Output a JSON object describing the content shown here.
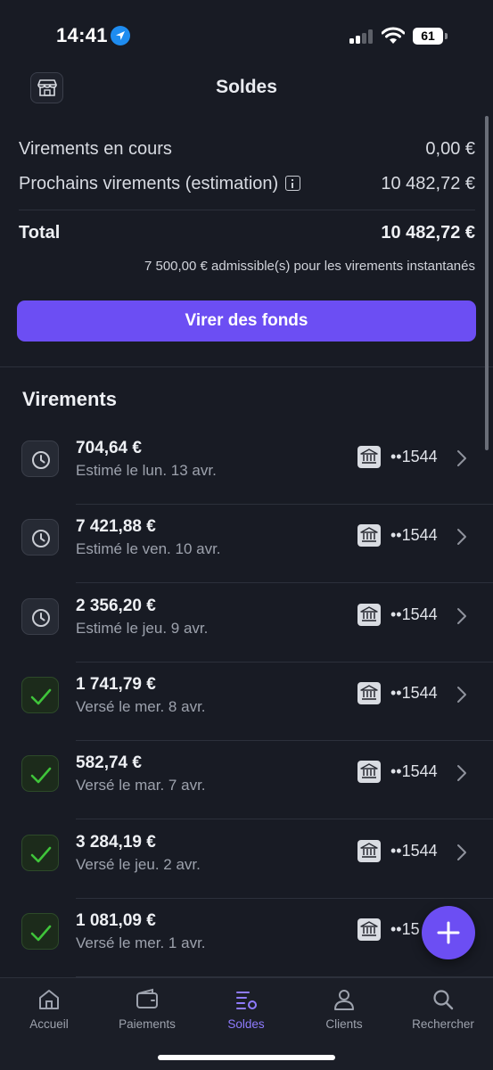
{
  "status_bar": {
    "time": "14:41",
    "battery": "61"
  },
  "header": {
    "title": "Soldes",
    "store_icon": "store-icon"
  },
  "summary": {
    "pending_label": "Virements en cours",
    "pending_value": "0,00 €",
    "upcoming_label": "Prochains virements (estimation)",
    "upcoming_value": "10 482,72 €",
    "total_label": "Total",
    "total_value": "10 482,72 €",
    "eligible_note": "7 500,00 € admissible(s) pour les virements instantanés"
  },
  "actions": {
    "transfer_button": "Virer des fonds"
  },
  "transfers": {
    "title": "Virements",
    "items": [
      {
        "amount": "704,64 €",
        "date": "Estimé le lun. 13 avr.",
        "status": "pending",
        "account": "••1544"
      },
      {
        "amount": "7 421,88 €",
        "date": "Estimé le ven. 10 avr.",
        "status": "pending",
        "account": "••1544"
      },
      {
        "amount": "2 356,20 €",
        "date": "Estimé le jeu. 9 avr.",
        "status": "pending",
        "account": "••1544"
      },
      {
        "amount": "1 741,79 €",
        "date": "Versé le mer. 8 avr.",
        "status": "paid",
        "account": "••1544"
      },
      {
        "amount": "582,74 €",
        "date": "Versé le mar. 7 avr.",
        "status": "paid",
        "account": "••1544"
      },
      {
        "amount": "3 284,19 €",
        "date": "Versé le jeu. 2 avr.",
        "status": "paid",
        "account": "••1544"
      },
      {
        "amount": "1 081,09 €",
        "date": "Versé le mer. 1 avr.",
        "status": "paid",
        "account": "••15"
      }
    ]
  },
  "tabs": [
    {
      "label": "Accueil",
      "icon": "home-icon",
      "active": false
    },
    {
      "label": "Paiements",
      "icon": "wallet-icon",
      "active": false
    },
    {
      "label": "Soldes",
      "icon": "balances-icon",
      "active": true
    },
    {
      "label": "Clients",
      "icon": "person-icon",
      "active": false
    },
    {
      "label": "Rechercher",
      "icon": "search-icon",
      "active": false
    }
  ],
  "colors": {
    "accent": "#6c4ef3",
    "active_tab": "#8f7bff",
    "background": "#181b24",
    "paid_check": "#3fc43a"
  }
}
